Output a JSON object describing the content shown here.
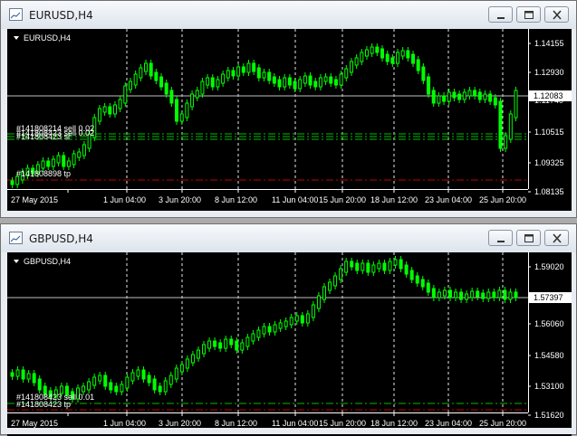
{
  "windows": [
    {
      "title": "EURUSD,H4",
      "symbol_label": "EURUSD,H4",
      "current_price": "1.12083",
      "price_axis": [
        "1.14155",
        "1.12930",
        "1.11740",
        "1.10515",
        "1.09325",
        "1.08135"
      ],
      "time_axis": [
        "27 May 2015",
        "1 Jun 04:00",
        "3 Jun 20:00",
        "8 Jun 12:00",
        "11 Jun 04:00",
        "15 Jun 20:00",
        "18 Jun 12:00",
        "23 Jun 04:00",
        "25 Jun 20:00"
      ],
      "order_labels": [
        "#141808214 sell 0.02",
        "#141808423 sell 0.02",
        "#141808423 sl",
        "#141808898 tp"
      ],
      "colors": {
        "candles": "#00ff00",
        "sl_line": "#00c000",
        "tp_line": "#c00000",
        "grid": "#ffffff",
        "bid_line": "#c0c0c0"
      }
    },
    {
      "title": "GBPUSD,H4",
      "symbol_label": "GBPUSD,H4",
      "current_price": "1.57397",
      "price_axis": [
        "1.59020",
        "1.57540",
        "1.56060",
        "1.54580",
        "1.53100",
        "1.51620"
      ],
      "time_axis": [
        "27 May 2015",
        "1 Jun 04:00",
        "3 Jun 20:00",
        "8 Jun 12:00",
        "11 Jun 04:00",
        "15 Jun 20:00",
        "18 Jun 12:00",
        "23 Jun 04:00",
        "25 Jun 20:00"
      ],
      "order_labels": [
        "#141808423 sell 0.01",
        "#141808423 tp"
      ],
      "colors": {
        "candles": "#00ff00",
        "sl_line": "#00c000",
        "tp_line": "#c00000",
        "grid": "#ffffff",
        "bid_line": "#c0c0c0"
      }
    }
  ],
  "window_buttons": {
    "minimize": "minimize-icon",
    "restore": "restore-icon",
    "close": "close-icon"
  }
}
